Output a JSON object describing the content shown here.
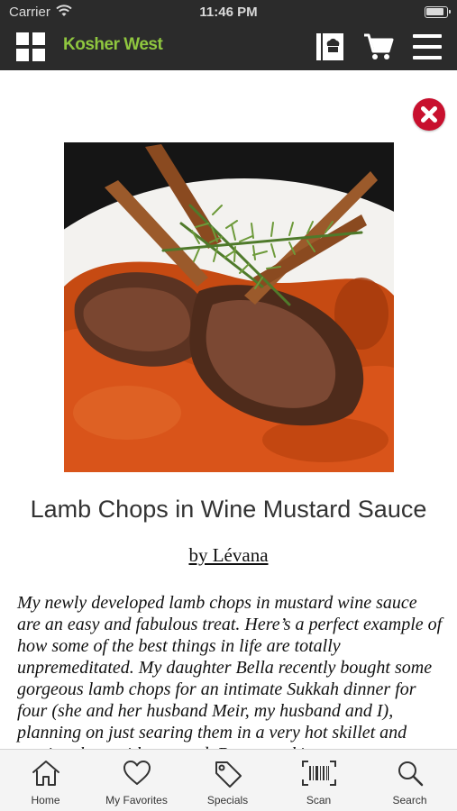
{
  "status_bar": {
    "carrier": "Carrier",
    "time": "11:46 PM"
  },
  "header": {
    "brand": "Kosher West",
    "brand_color": "#8fc63f",
    "background": "#2b2b2b",
    "icons": [
      "grid-icon",
      "recipe-book-icon",
      "cart-icon",
      "menu-icon"
    ]
  },
  "recipe": {
    "title": "Lamb Chops in Wine Mustard Sauce",
    "author": "by Lévana",
    "description": "My newly developed lamb chops in mustard wine sauce are an easy and fabulous treat. Here’s a perfect example of how some of the best things in life are totally unpremeditated. My daughter Bella recently bought some gorgeous lamb chops for an intimate Sukkah dinner for four (she and her husband Meir, my husband and I), planning on just searing them in a very hot skillet and serving them with mustard. But at cooking"
  },
  "close_button": {
    "icon": "close-icon",
    "color": "#c8102e"
  },
  "tab_bar": {
    "items": [
      {
        "label": "Home",
        "icon": "home-icon"
      },
      {
        "label": "My Favorites",
        "icon": "heart-icon"
      },
      {
        "label": "Specials",
        "icon": "tag-icon"
      },
      {
        "label": "Scan",
        "icon": "barcode-icon"
      },
      {
        "label": "Search",
        "icon": "search-icon"
      }
    ]
  }
}
